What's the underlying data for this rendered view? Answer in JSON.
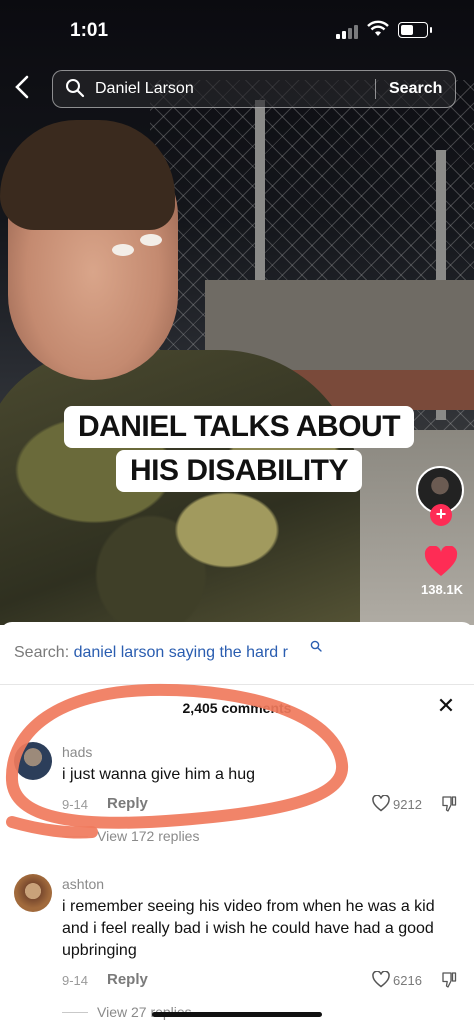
{
  "status": {
    "time": "1:01"
  },
  "search": {
    "query": "Daniel Larson",
    "button": "Search"
  },
  "video": {
    "caption_line1": "DANIEL TALKS ABOUT",
    "caption_line2": "HIS DISABILITY",
    "likes": "138.1K",
    "follow_symbol": "+"
  },
  "comments_panel": {
    "suggested_prefix": "Search:",
    "suggested_query": "daniel larson saying the hard r",
    "count_label": "2,405 comments",
    "close_symbol": "✕",
    "comments": [
      {
        "user": "hads",
        "text": "i just wanna give him a hug",
        "date": "9-14",
        "reply_label": "Reply",
        "likes": "9212",
        "view_replies": "View 172 replies"
      },
      {
        "user": "ashton",
        "text": "i remember seeing his video from when he was a kid and i feel really bad i wish he could have had a good upbringing",
        "date": "9-14",
        "reply_label": "Reply",
        "likes": "6216",
        "view_replies": "View 27 replies"
      }
    ]
  },
  "colors": {
    "accent": "#fe2c55",
    "link": "#2a5db0",
    "annotation": "#f07a5c"
  }
}
